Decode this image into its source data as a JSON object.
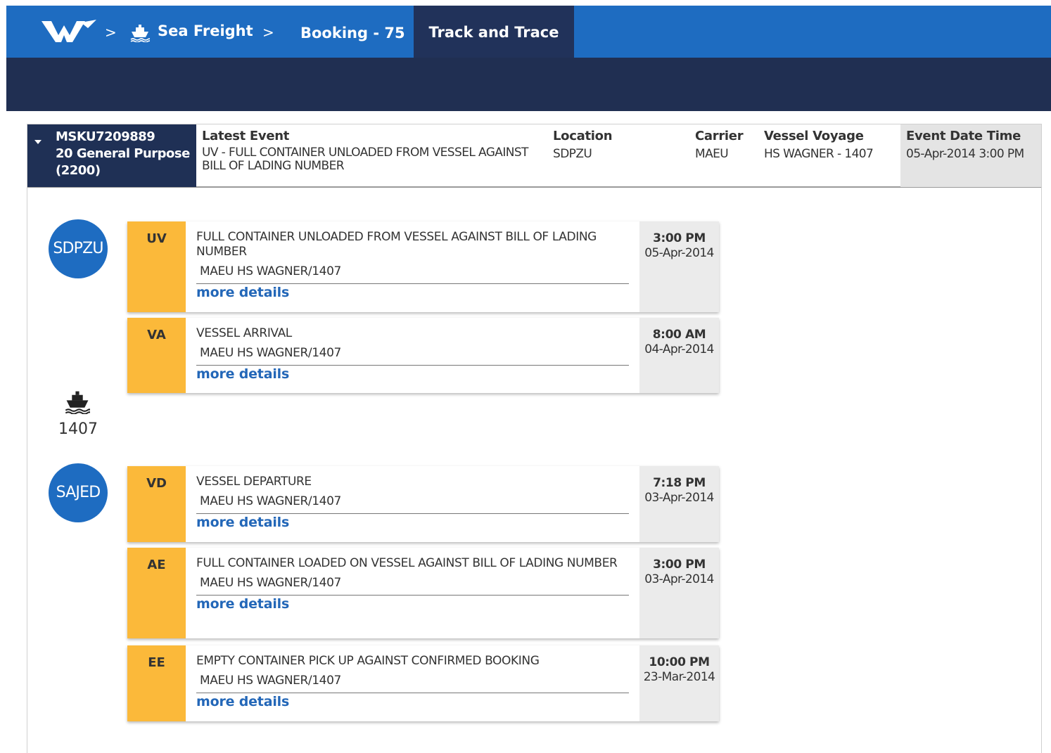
{
  "nav": {
    "logo_icon": "company-logo-icon",
    "crumbs": [
      {
        "label": "Sea Freight",
        "icon": "ship-icon"
      },
      {
        "label": "Booking - 75"
      }
    ],
    "separator": ">",
    "active_tab": "Track and Trace"
  },
  "summary": {
    "container_id": "MSKU7209889",
    "container_type": "20 General Purpose (2200)",
    "latest_event_label": "Latest Event",
    "latest_event_value": "UV - FULL CONTAINER UNLOADED FROM VESSEL AGAINST BILL OF LADING NUMBER",
    "location_label": "Location",
    "location_value": "SDPZU",
    "carrier_label": "Carrier",
    "carrier_value": "MAEU",
    "vessel_voyage_label": "Vessel Voyage",
    "vessel_voyage_value": "HS WAGNER - 1407",
    "event_date_label": "Event Date Time",
    "event_date_value": "05-Apr-2014 3:00 PM"
  },
  "timeline": {
    "locations": [
      "SDPZU",
      "SAJED"
    ],
    "voyage": "1407",
    "more_details": "more details",
    "events": [
      {
        "code": "UV",
        "title": "FULL CONTAINER UNLOADED FROM VESSEL AGAINST BILL OF LADING NUMBER",
        "sub": "MAEU  HS WAGNER/1407",
        "time": "3:00 PM",
        "date": "05-Apr-2014"
      },
      {
        "code": "VA",
        "title": "VESSEL ARRIVAL",
        "sub": "MAEU  HS WAGNER/1407",
        "time": "8:00 AM",
        "date": "04-Apr-2014"
      },
      {
        "code": "VD",
        "title": "VESSEL DEPARTURE",
        "sub": "MAEU  HS WAGNER/1407",
        "time": "7:18 PM",
        "date": "03-Apr-2014"
      },
      {
        "code": "AE",
        "title": "FULL CONTAINER LOADED ON VESSEL AGAINST BILL OF LADING NUMBER",
        "sub": "MAEU  HS WAGNER/1407",
        "time": "3:00 PM",
        "date": "03-Apr-2014"
      },
      {
        "code": "EE",
        "title": "EMPTY CONTAINER PICK UP AGAINST CONFIRMED BOOKING",
        "sub": "MAEU  HS WAGNER/1407",
        "time": "10:00 PM",
        "date": "23-Mar-2014"
      }
    ]
  },
  "colors": {
    "nav_blue": "#1e6cc1",
    "nav_dark": "#202f52",
    "event_code_bg": "#fbb93a",
    "link_blue": "#2367b8"
  }
}
